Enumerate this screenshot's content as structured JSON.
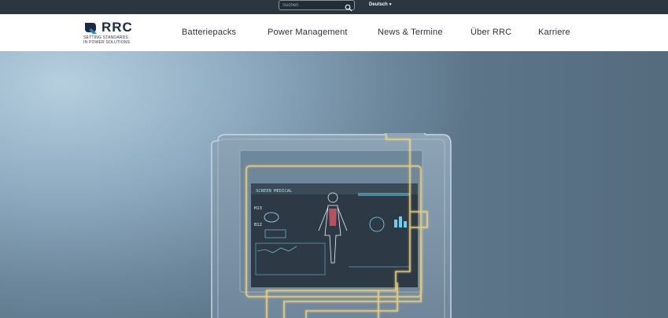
{
  "topbar": {
    "search": {
      "placeholder": "Suchen",
      "icon": "search-icon"
    },
    "language": {
      "label": "Deutsch",
      "icon": "chevron-down-icon"
    }
  },
  "header": {
    "logo": {
      "brand": "RRC",
      "tagline_1": "SETTING STANDARDS",
      "tagline_2": "IN POWER SOLUTIONS"
    },
    "nav": [
      {
        "label": "Batteriepacks"
      },
      {
        "label": "Power Management"
      },
      {
        "label": "News & Termine"
      },
      {
        "label": "Über RRC"
      },
      {
        "label": "Karriere"
      }
    ]
  },
  "hero": {
    "screen_title": "SCREEN MEDICAL",
    "readouts": [
      "H13",
      "B12"
    ]
  },
  "colors": {
    "topbar": "#2b3640",
    "brand_navy": "#1a2a44",
    "glow": "#f2d27a"
  }
}
